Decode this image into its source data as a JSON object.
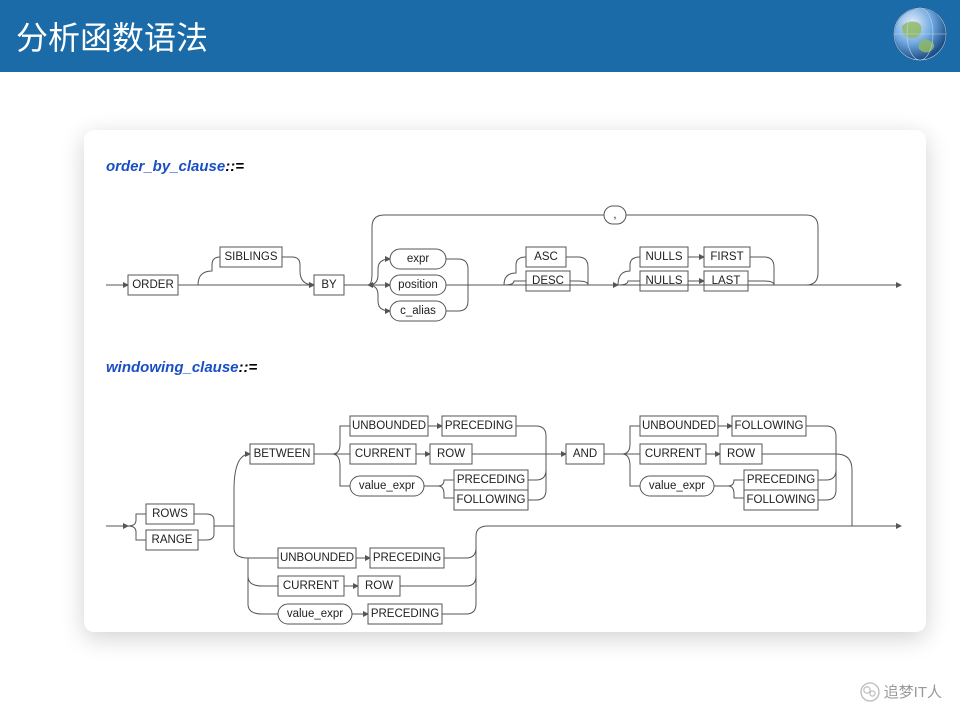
{
  "header": {
    "title": "分析函数语法"
  },
  "clauses": {
    "order_by": {
      "name": "order_by_clause",
      "eq": "::="
    },
    "windowing": {
      "name": "windowing_clause",
      "eq": "::="
    }
  },
  "tokens": {
    "order": "ORDER",
    "siblings": "SIBLINGS",
    "by": "BY",
    "expr": "expr",
    "position": "position",
    "c_alias": "c_alias",
    "asc": "ASC",
    "desc": "DESC",
    "nulls1": "NULLS",
    "first": "FIRST",
    "nulls2": "NULLS",
    "last": "LAST",
    "comma": ",",
    "rows": "ROWS",
    "range": "RANGE",
    "between": "BETWEEN",
    "and": "AND",
    "unbounded1": "UNBOUNDED",
    "preceding1": "PRECEDING",
    "current1": "CURRENT",
    "row1": "ROW",
    "value_expr1": "value_expr",
    "preceding2": "PRECEDING",
    "following1": "FOLLOWING",
    "unbounded2": "UNBOUNDED",
    "following2": "FOLLOWING",
    "current2": "CURRENT",
    "row2": "ROW",
    "value_expr2": "value_expr",
    "preceding3": "PRECEDING",
    "following3": "FOLLOWING",
    "unbounded3": "UNBOUNDED",
    "preceding4": "PRECEDING",
    "current3": "CURRENT",
    "row3": "ROW",
    "value_expr3": "value_expr",
    "preceding5": "PRECEDING"
  },
  "watermark": {
    "text": "追梦IT人"
  }
}
